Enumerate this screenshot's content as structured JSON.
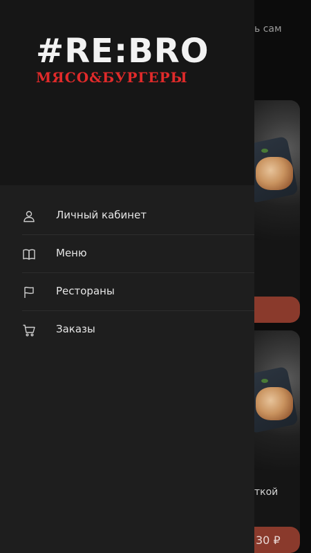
{
  "background": {
    "top_text": "ь сам",
    "cards": [
      {
        "title": "",
        "price": ""
      },
      {
        "title": "ткой",
        "price": "30 ₽"
      }
    ]
  },
  "drawer": {
    "logo": {
      "main": "#RE:BRO",
      "sub": "МЯСО&БУРГЕРЫ"
    },
    "menu": [
      {
        "label": "Личный кабинет",
        "icon": "user-icon"
      },
      {
        "label": "Меню",
        "icon": "book-icon"
      },
      {
        "label": "Рестораны",
        "icon": "flag-icon"
      },
      {
        "label": "Заказы",
        "icon": "cart-icon"
      }
    ]
  },
  "colors": {
    "drawer_bg": "#1e1e1e",
    "header_bg": "#161616",
    "brand_red": "#e02a2a",
    "button_red": "#8a3a2c"
  }
}
